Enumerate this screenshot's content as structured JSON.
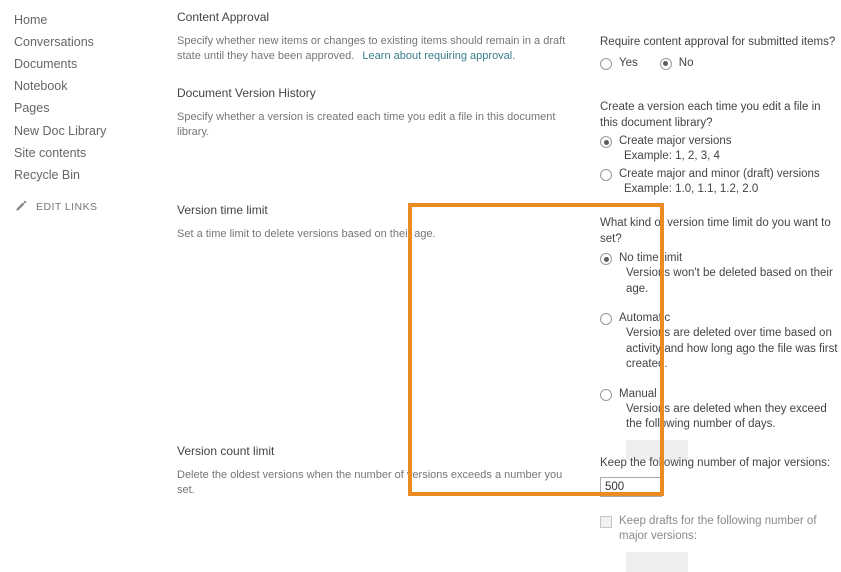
{
  "sidebar": {
    "items": [
      {
        "label": "Home"
      },
      {
        "label": "Conversations"
      },
      {
        "label": "Documents"
      },
      {
        "label": "Notebook"
      },
      {
        "label": "Pages"
      },
      {
        "label": "New Doc Library"
      },
      {
        "label": "Site contents"
      },
      {
        "label": "Recycle Bin"
      }
    ],
    "edit_links": {
      "label": "EDIT LINKS",
      "icon": "pencil-icon"
    }
  },
  "sections": {
    "content_approval": {
      "title": "Content Approval",
      "description": "Specify whether new items or changes to existing items should remain in a draft state until they have been approved.",
      "link_text": "Learn about requiring approval.",
      "question": "Require content approval for submitted items?",
      "options": [
        {
          "label": "Yes",
          "selected": false
        },
        {
          "label": "No",
          "selected": true
        }
      ]
    },
    "version_history": {
      "title": "Document Version History",
      "description": "Specify whether a version is created each time you edit a file in this document library.",
      "question": "Create a version each time you edit a file in this document library?",
      "options": [
        {
          "label": "Create major versions",
          "example": "Example: 1, 2, 3, 4",
          "selected": true
        },
        {
          "label": "Create major and minor (draft) versions",
          "example": "Example: 1.0, 1.1, 1.2, 2.0",
          "selected": false
        }
      ]
    },
    "version_time_limit": {
      "title": "Version time limit",
      "description": "Set a time limit to delete versions based on their age.",
      "question": "What kind of version time limit do you want to set?",
      "options": [
        {
          "label": "No time limit",
          "detail": "Versions won't be deleted based on their age.",
          "selected": true
        },
        {
          "label": "Automatic",
          "detail": "Versions are deleted over time based on activity and how long ago the file was first created.",
          "selected": false
        },
        {
          "label": "Manual",
          "detail": "Versions are deleted when they exceed the following number of days.",
          "selected": false,
          "input_value": "",
          "input_disabled": true
        }
      ]
    },
    "version_count_limit": {
      "title": "Version count limit",
      "description": "Delete the oldest versions when the number of versions exceeds a number you set.",
      "major_versions_label": "Keep the following number of major versions:",
      "major_versions_value": "500",
      "drafts_checkbox_label": "Keep drafts for the following number of major versions:",
      "drafts_checked": false,
      "drafts_value": "",
      "drafts_input_disabled": true
    }
  },
  "highlight": {
    "color": "#ea8c22",
    "target": "version-time-limit-and-count-panel"
  }
}
